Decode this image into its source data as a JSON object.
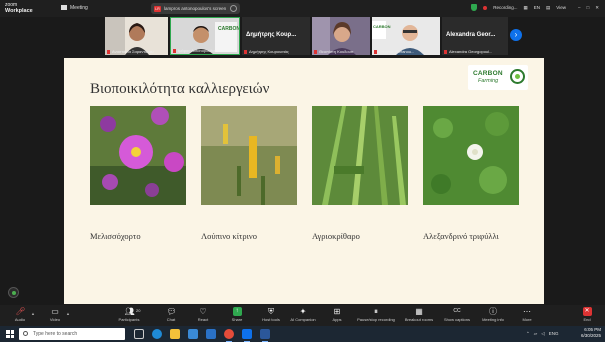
{
  "titlebar": {
    "brand_line1": "zoom",
    "brand_line2": "Workplace",
    "meeting_label": "Meeting",
    "share_badge": "LR",
    "share_text": "lampros antonopoulos's screen",
    "recording_label": "Recording...",
    "lang": "EN",
    "view_label": "View",
    "window_controls": [
      "–",
      "□",
      "✕"
    ]
  },
  "gallery": {
    "tiles": [
      {
        "name": "Αναστασία Σαραντάκου",
        "type": "video"
      },
      {
        "name": "Ιμάρος Antonopoulos",
        "type": "video"
      },
      {
        "name": "Δημήτρης Κουρουσιάς",
        "big_name": "Δημήτρης Κουρ...",
        "type": "name"
      },
      {
        "name": "Θεοπίστη Κουδουπ",
        "type": "video"
      },
      {
        "name": "Στέργιος Stefanou...",
        "type": "video"
      },
      {
        "name": "Alexandra Georgopoul...",
        "big_name": "Alexandra Geor...",
        "type": "name"
      }
    ],
    "next_icon": "›"
  },
  "slide": {
    "title": "Βιοποικιλότητα καλλιεργειών",
    "logo_word1": "CARBON",
    "logo_word2": "Farming",
    "photos": [
      {
        "caption": "Μελισσόχορτο",
        "subject": "pink-flowers"
      },
      {
        "caption": "Λούπινο κίτρινο",
        "subject": "yellow-lupine"
      },
      {
        "caption": "Αγριοκρίθαρο",
        "subject": "wild-barley"
      },
      {
        "caption": "Αλεξανδρινό τριφύλλι",
        "subject": "white-clover"
      }
    ]
  },
  "toolbar": {
    "items": [
      {
        "label": "Audio",
        "icon": "mic-muted-icon"
      },
      {
        "label": "Video",
        "icon": "camera-icon"
      },
      {
        "label": "Participants",
        "icon": "participants-icon",
        "count": "20"
      },
      {
        "label": "Chat",
        "icon": "chat-icon"
      },
      {
        "label": "React",
        "icon": "heart-icon"
      },
      {
        "label": "Share",
        "icon": "share-icon"
      },
      {
        "label": "Host tools",
        "icon": "shield-icon"
      },
      {
        "label": "AI Companion",
        "icon": "sparkle-icon"
      },
      {
        "label": "Apps",
        "icon": "apps-icon"
      },
      {
        "label": "Pause/stop recording",
        "icon": "recording-icon"
      },
      {
        "label": "Breakout rooms",
        "icon": "grid-icon"
      },
      {
        "label": "Show captions",
        "icon": "cc-icon"
      },
      {
        "label": "Meeting info",
        "icon": "info-icon"
      },
      {
        "label": "More",
        "icon": "more-icon"
      },
      {
        "label": "End",
        "icon": "end-icon"
      }
    ]
  },
  "taskbar": {
    "search_placeholder": "Type here to search",
    "lang": "ENG",
    "time": "6:05 PM",
    "date": "6/30/2025"
  },
  "colors": {
    "slide_bg": "#fbf5e6",
    "zoom_blue": "#0e71eb",
    "end_red": "#dd3333",
    "share_green": "#2fa84f",
    "logo_green": "#2d7a2e"
  }
}
